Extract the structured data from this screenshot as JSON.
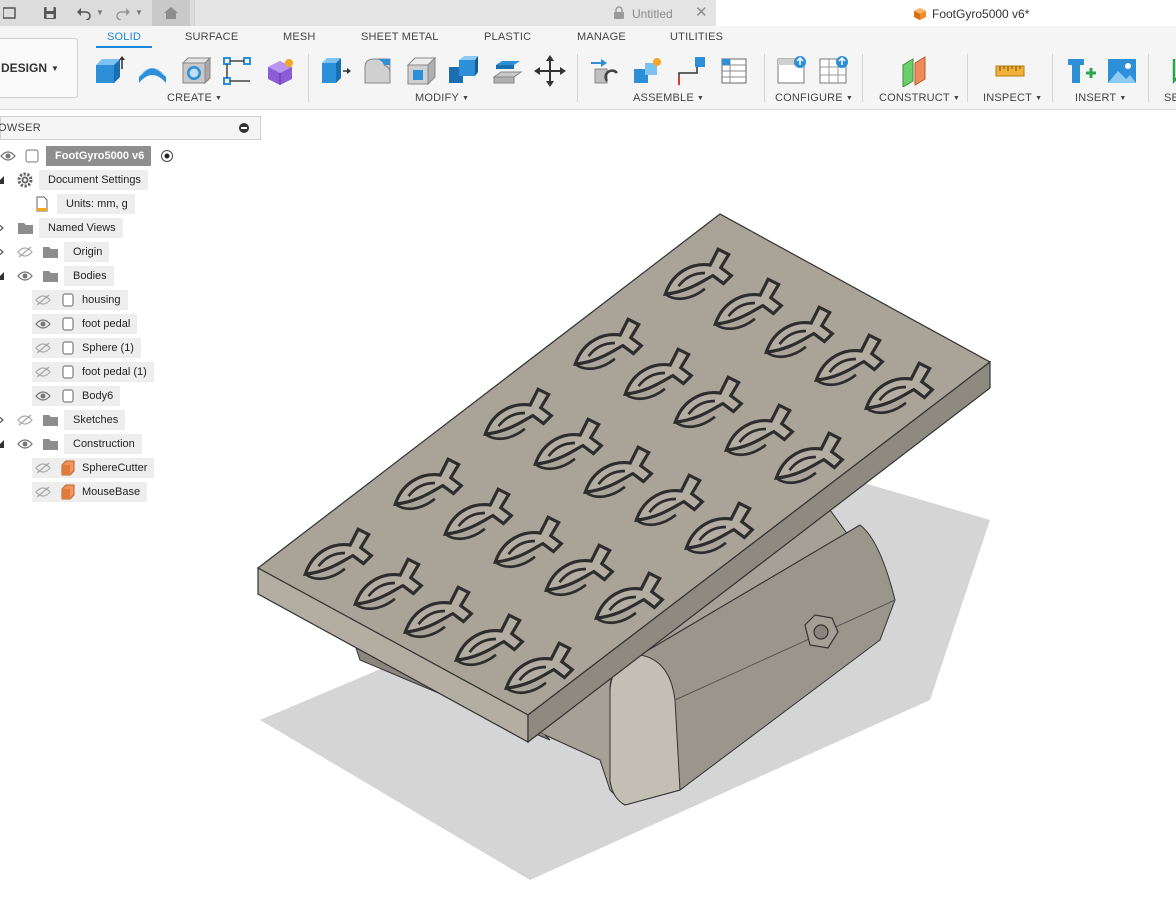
{
  "window": {
    "tabs": [
      {
        "label": "Untitled",
        "active": false
      },
      {
        "label": "FootGyro5000 v6*",
        "active": true
      }
    ]
  },
  "workspace": {
    "label": "DESIGN"
  },
  "ribbon": {
    "tabs": [
      "SOLID",
      "SURFACE",
      "MESH",
      "SHEET METAL",
      "PLASTIC",
      "MANAGE",
      "UTILITIES"
    ],
    "active_tab": "SOLID",
    "groups": [
      "CREATE",
      "MODIFY",
      "ASSEMBLE",
      "CONFIGURE",
      "CONSTRUCT",
      "INSPECT",
      "INSERT",
      "SE"
    ],
    "accent_color": "#1d86d8"
  },
  "browser": {
    "title": "OWSER",
    "root": "FootGyro5000 v6",
    "items": [
      {
        "label": "Document Settings",
        "icon": "gear-icon"
      },
      {
        "label": "Units: mm, g",
        "icon": "document-icon"
      },
      {
        "label": "Named Views",
        "icon": "folder-icon"
      },
      {
        "label": "Origin",
        "icon": "folder-icon"
      },
      {
        "label": "Bodies",
        "icon": "folder-icon"
      },
      {
        "label": "housing",
        "icon": "body-icon",
        "visible": false
      },
      {
        "label": "foot pedal",
        "icon": "body-icon",
        "visible": true
      },
      {
        "label": "Sphere (1)",
        "icon": "body-icon",
        "visible": false
      },
      {
        "label": "foot pedal (1)",
        "icon": "body-icon",
        "visible": false
      },
      {
        "label": "Body6",
        "icon": "body-icon",
        "visible": true
      },
      {
        "label": "Sketches",
        "icon": "folder-icon"
      },
      {
        "label": "Construction",
        "icon": "folder-icon"
      },
      {
        "label": "SphereCutter",
        "icon": "plane-icon",
        "visible": false
      },
      {
        "label": "MouseBase",
        "icon": "plane-icon",
        "visible": false
      }
    ]
  },
  "model": {
    "name": "foot pedal",
    "color": "#a59f93",
    "motif": "fish-icon"
  }
}
